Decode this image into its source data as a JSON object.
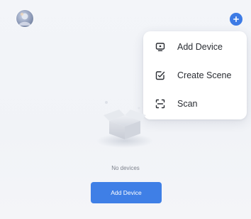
{
  "header": {
    "avatar_icon": "user-avatar",
    "add_icon": "plus-circle-icon",
    "accent_color": "#3d7be5"
  },
  "menu": {
    "items": [
      {
        "label": "Add Device",
        "icon": "device-screen-icon"
      },
      {
        "label": "Create Scene",
        "icon": "edit-checkbox-icon"
      },
      {
        "label": "Scan",
        "icon": "scan-frame-icon"
      }
    ]
  },
  "empty_state": {
    "illustration": "empty-box-illustration",
    "message": "No devices",
    "button_label": "Add Device",
    "button_color": "#3f7fe6"
  }
}
